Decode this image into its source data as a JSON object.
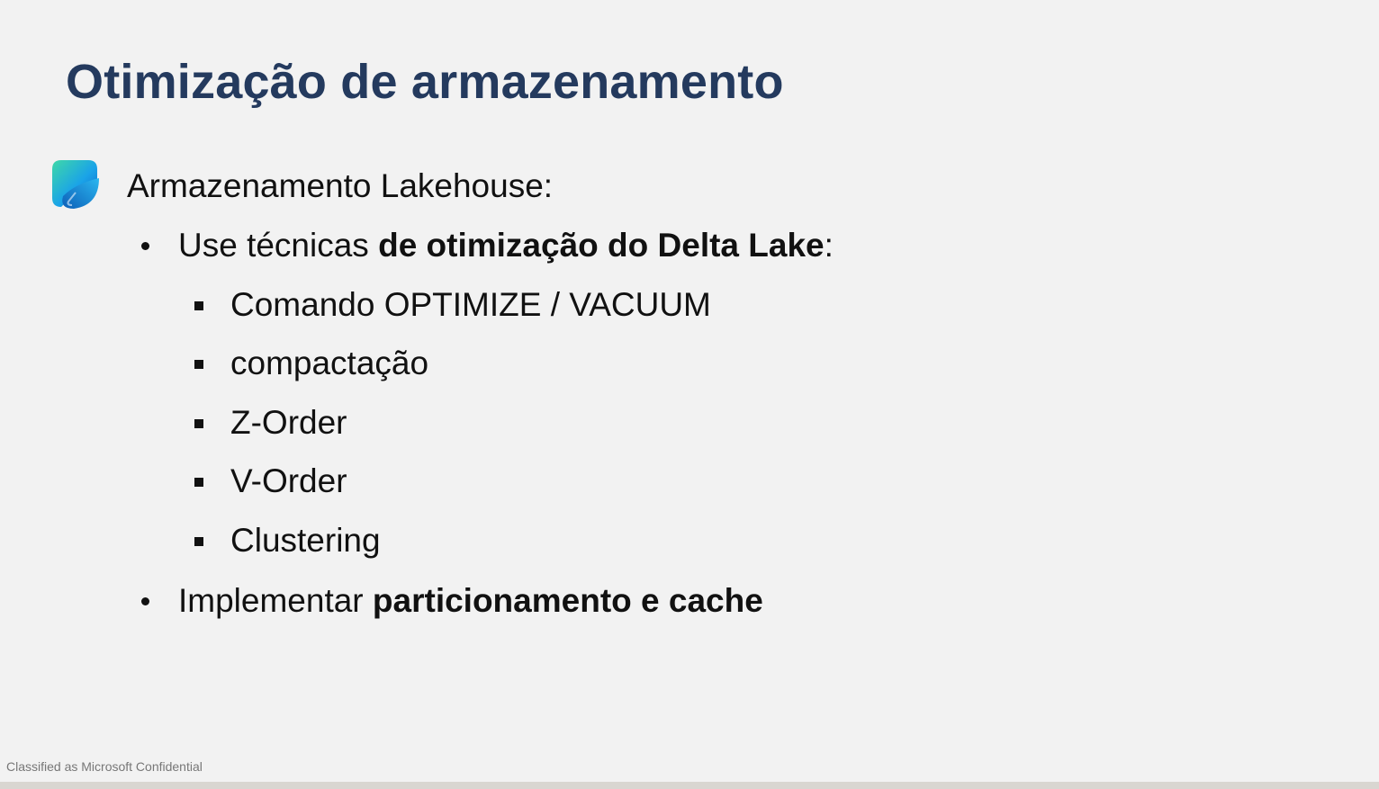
{
  "slide": {
    "title": "Otimização de armazenamento",
    "heading": "Armazenamento Lakehouse:",
    "bullet1": {
      "prefix": "Use  técnicas ",
      "bold": "de otimização do Delta Lake",
      "suffix": ":"
    },
    "sub_items": [
      "Comando OPTIMIZE / VACUUM",
      "compactação",
      "Z-Order",
      "V-Order",
      "Clustering"
    ],
    "bullet2": {
      "prefix": "Implementar ",
      "bold": "particionamento e cache"
    },
    "footer": "Classified as Microsoft Confidential"
  },
  "icons": {
    "logo": "microsoft-fabric-logo"
  },
  "colors": {
    "title": "#243a5e",
    "background": "#f2f2f2",
    "text": "#111111"
  }
}
